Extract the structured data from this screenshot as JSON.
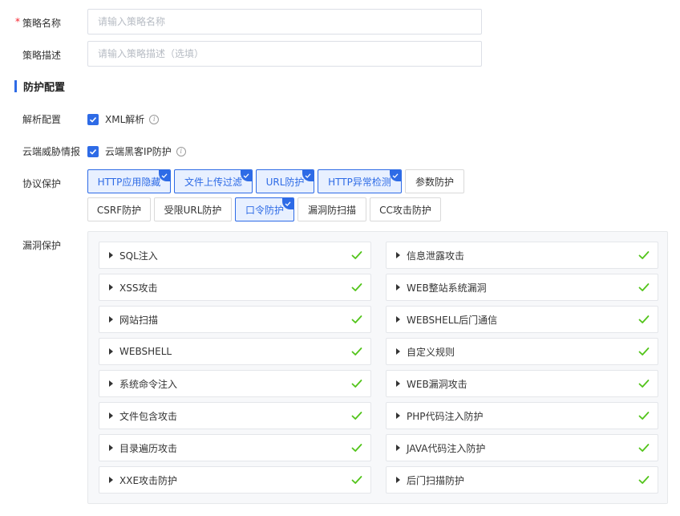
{
  "form": {
    "required_mark": "*",
    "name_label": "策略名称",
    "name_placeholder": "请输入策略名称",
    "desc_label": "策略描述",
    "desc_placeholder": "请输入策略描述（选填）"
  },
  "section": {
    "title": "防护配置"
  },
  "parse": {
    "label": "解析配置",
    "option": "XML解析"
  },
  "cloud": {
    "label": "云端威胁情报",
    "option": "云端黑客IP防护"
  },
  "protocol": {
    "label": "协议保护",
    "tags": [
      {
        "label": "HTTP应用隐藏",
        "selected": true
      },
      {
        "label": "文件上传过滤",
        "selected": true
      },
      {
        "label": "URL防护",
        "selected": true
      },
      {
        "label": "HTTP异常检测",
        "selected": true
      },
      {
        "label": "参数防护",
        "selected": false
      },
      {
        "label": "CSRF防护",
        "selected": false
      },
      {
        "label": "受限URL防护",
        "selected": false
      },
      {
        "label": "口令防护",
        "selected": true
      },
      {
        "label": "漏洞防扫描",
        "selected": false
      },
      {
        "label": "CC攻击防护",
        "selected": false
      }
    ]
  },
  "vuln": {
    "label": "漏洞保护",
    "left": [
      "SQL注入",
      "XSS攻击",
      "网站扫描",
      "WEBSHELL",
      "系统命令注入",
      "文件包含攻击",
      "目录遍历攻击",
      "XXE攻击防护"
    ],
    "right": [
      "信息泄露攻击",
      "WEB整站系统漏洞",
      "WEBSHELL后门通信",
      "自定义规则",
      "WEB漏洞攻击",
      "PHP代码注入防护",
      "JAVA代码注入防护",
      "后门扫描防护"
    ]
  },
  "colors": {
    "primary": "#2e6be6",
    "check": "#52c41a",
    "required": "#f5222d"
  }
}
